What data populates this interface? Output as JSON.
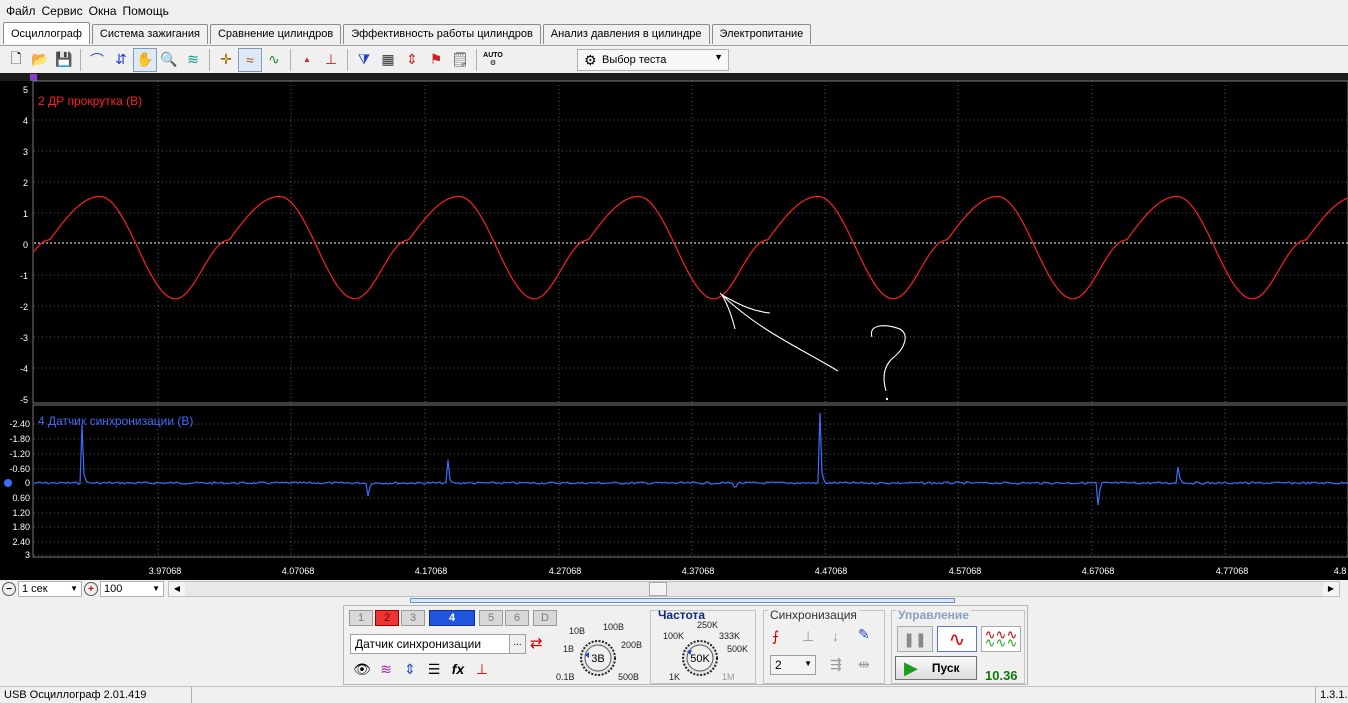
{
  "menu": [
    "Файл",
    "Сервис",
    "Окна",
    "Помощь"
  ],
  "tabs": [
    "Осциллограф",
    "Система зажигания",
    "Сравнение цилиндров",
    "Эффективность работы цилиндров",
    "Анализ давления в цилиндре",
    "Электропитание"
  ],
  "active_tab": 0,
  "toolbar": {
    "test_select": "Выбор теста",
    "auto_label": "AUTO"
  },
  "scope": {
    "ch2_label": "2 ДР прокрутка (В)",
    "ch4_label": "4 Датчик синхронизации (В)",
    "ch2_ticks": [
      "5",
      "4",
      "3",
      "2",
      "1",
      "0",
      "-1",
      "-2",
      "-3",
      "-4",
      "-5"
    ],
    "ch4_ticks": [
      "-2.40",
      "-1.80",
      "-1.20",
      "-0.60",
      "0",
      "0.60",
      "1.20",
      "1.80",
      "2.40",
      "3"
    ],
    "time_ticks": [
      "3.97068",
      "4.07068",
      "4.17068",
      "4.27068",
      "4.37068",
      "4.47068",
      "4.57068",
      "4.67068",
      "4.77068",
      "4.8"
    ],
    "annotation": "?",
    "colors": {
      "ch2": "#ff2020",
      "ch4": "#3b6cff",
      "grid": "#5a5a5a",
      "zero_line": "#ffffff"
    }
  },
  "controls": {
    "timebase": "1 сек",
    "zoom": "100"
  },
  "channel_panel": {
    "channels": [
      "1",
      "2",
      "3",
      "4",
      "5",
      "6",
      "D"
    ],
    "selected_channel": "4",
    "sensor": "Датчик синхронизации",
    "sensor_button": "...",
    "voltage_knob": {
      "value": "3В",
      "labels": [
        "10В",
        "100В",
        "1В",
        "200В",
        "0.1В",
        "500В"
      ]
    },
    "freq_title": "Частота",
    "freq_knob": {
      "value": "50K",
      "labels": [
        "250K",
        "100K",
        "333K",
        "500K",
        "1K",
        "1M"
      ]
    },
    "sync_title": "Синхронизация",
    "sync_channel": "2",
    "control_title": "Управление",
    "start_button": "Пуск",
    "timer": "10.36"
  },
  "statusbar": {
    "app": "USB Осциллограф  2.01.419",
    "version": "1.3.1."
  }
}
